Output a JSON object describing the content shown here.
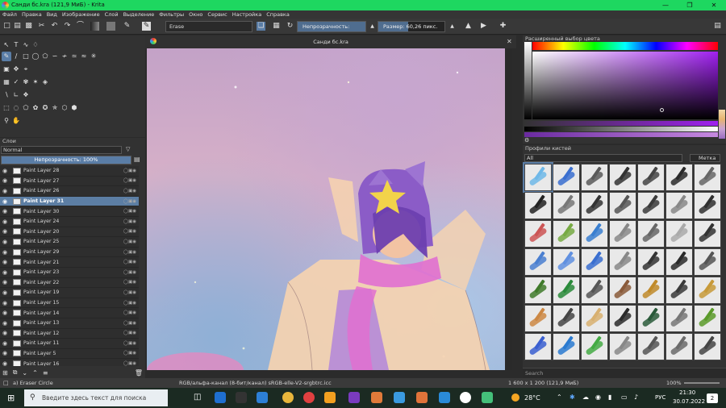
{
  "window": {
    "title": "Санди бс.kra (121,9 МиБ) - Krita"
  },
  "menu": [
    "Файл",
    "Правка",
    "Вид",
    "Изображение",
    "Слой",
    "Выделение",
    "Фильтры",
    "Окно",
    "Сервис",
    "Настройка",
    "Справка"
  ],
  "toolbar": {
    "brush_name": "Erase",
    "opacity_label": "Непрозрачность: 100%",
    "opacity_value": 1.0,
    "size_label": "Размер: 60,26 пикс.",
    "size_fill": 0.45
  },
  "canvas": {
    "tab_title": "Санди бс.kra"
  },
  "layers": {
    "title": "Слои",
    "blend_mode": "Normal",
    "opacity_label": "Непрозрачность: 100%",
    "items": [
      {
        "name": "Paint Layer 28",
        "selected": false
      },
      {
        "name": "Paint Layer 27",
        "selected": false
      },
      {
        "name": "Paint Layer 26",
        "selected": false
      },
      {
        "name": "Paint Layer 31",
        "selected": true
      },
      {
        "name": "Paint Layer 30",
        "selected": false
      },
      {
        "name": "Paint Layer 24",
        "selected": false
      },
      {
        "name": "Paint Layer 20",
        "selected": false
      },
      {
        "name": "Paint Layer 25",
        "selected": false
      },
      {
        "name": "Paint Layer 29",
        "selected": false
      },
      {
        "name": "Paint Layer 21",
        "selected": false
      },
      {
        "name": "Paint Layer 23",
        "selected": false
      },
      {
        "name": "Paint Layer 22",
        "selected": false
      },
      {
        "name": "Paint Layer 19",
        "selected": false
      },
      {
        "name": "Paint Layer 15",
        "selected": false
      },
      {
        "name": "Paint Layer 14",
        "selected": false
      },
      {
        "name": "Paint Layer 13",
        "selected": false
      },
      {
        "name": "Paint Layer 12",
        "selected": false
      },
      {
        "name": "Paint Layer 11",
        "selected": false
      },
      {
        "name": "Paint Layer 5",
        "selected": false
      },
      {
        "name": "Paint Layer 16",
        "selected": false
      }
    ]
  },
  "color_selector": {
    "title": "Расширенный выбор цвета",
    "accent": "#a020f0"
  },
  "brushes": {
    "title": "Профили кистей",
    "filter": "All",
    "tag_label": "Метка",
    "search_placeholder": "Search"
  },
  "status": {
    "tool": "a) Eraser Circle",
    "color_space": "RGB/альфа-канал (8-бит/канал)  sRGB-elle-V2-srgbtrc.icc",
    "dimensions": "1 600 x 1 200 (121,9 МиБ)",
    "zoom": "100%"
  },
  "taskbar": {
    "search_placeholder": "Введите здесь текст для поиска",
    "weather": "28°C",
    "lang": "РУС",
    "time": "21:30",
    "date": "30.07.2022",
    "notifications": "2"
  }
}
